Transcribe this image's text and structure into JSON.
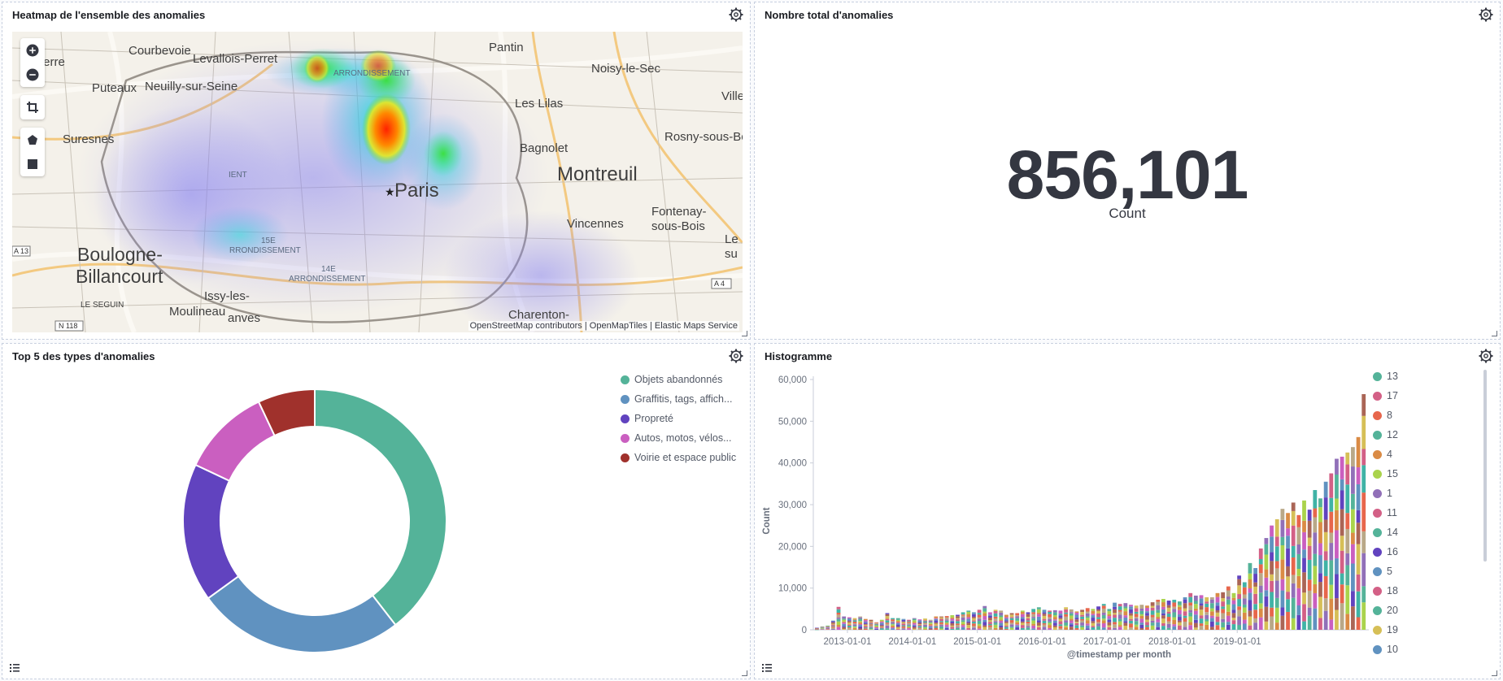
{
  "heatmap_panel": {
    "title": "Heatmap de l'ensemble des anomalies",
    "place_labels": [
      "Courbevoie",
      "Levallois-Perret",
      "Pantin",
      "Noisy-le-Sec",
      "Puteaux",
      "Neuilly-sur-Seine",
      "Les Lilas",
      "Suresnes",
      "Bagnolet",
      "Rosny-sous-Bo",
      "Montreuil",
      "Paris",
      "Fontenay-",
      "sous-Bois",
      "Vincennes",
      "Boulogne-",
      "Billancourt",
      "Issy-les-",
      "Moulineau",
      "Charenton-",
      "LE SEGUIN",
      "ARRONDISSEMENT",
      "15E",
      "RRONDISSEMENT",
      "14E",
      "ARRONDISSEMENT",
      "IENT",
      "Ville",
      "Le",
      "su",
      "terre",
      "anves"
    ],
    "road_badges": [
      "A 13",
      "A 4",
      "N 118"
    ],
    "attribution": [
      "OpenStreetMap contributors",
      "OpenMapTiles",
      "Elastic Maps Service"
    ],
    "icons": [
      "zoom-in-icon",
      "zoom-out-icon",
      "crop-icon",
      "polygon-icon",
      "square-icon"
    ]
  },
  "metric_panel": {
    "title": "Nombre total d'anomalies",
    "value": "856,101",
    "label": "Count"
  },
  "donut_panel": {
    "title": "Top 5 des types d'anomalies",
    "legend": [
      {
        "label": "Objets abandonnés",
        "color": "#54b399"
      },
      {
        "label": "Graffitis, tags, affich...",
        "color": "#6092c0"
      },
      {
        "label": "Propreté",
        "color": "#6143bf"
      },
      {
        "label": "Autos, motos, vélos...",
        "color": "#ca5fc0"
      },
      {
        "label": "Voirie et espace public",
        "color": "#a0312c"
      }
    ]
  },
  "histogram_panel": {
    "title": "Histogramme",
    "x_title": "@timestamp per month",
    "y_title": "Count",
    "legend": [
      {
        "label": "13",
        "color": "#54b399"
      },
      {
        "label": "17",
        "color": "#d36086"
      },
      {
        "label": "8",
        "color": "#e7664c"
      },
      {
        "label": "12",
        "color": "#54b399"
      },
      {
        "label": "4",
        "color": "#da8b45"
      },
      {
        "label": "15",
        "color": "#aad34c"
      },
      {
        "label": "1",
        "color": "#9170b8"
      },
      {
        "label": "11",
        "color": "#d36086"
      },
      {
        "label": "14",
        "color": "#54b399"
      },
      {
        "label": "16",
        "color": "#6143bf"
      },
      {
        "label": "5",
        "color": "#6092c0"
      },
      {
        "label": "18",
        "color": "#d36086"
      },
      {
        "label": "20",
        "color": "#54b399"
      },
      {
        "label": "19",
        "color": "#d6bf57"
      },
      {
        "label": "10",
        "color": "#6092c0"
      }
    ]
  },
  "chart_data": [
    {
      "type": "pie",
      "title": "Top 5 des types d'anomalies",
      "categories": [
        "Objets abandonnés",
        "Graffitis, tags, affich...",
        "Propreté",
        "Autos, motos, vélos...",
        "Voirie et espace public"
      ],
      "values": [
        39.5,
        25.5,
        17,
        11,
        7
      ],
      "colors": [
        "#54b399",
        "#6092c0",
        "#6143bf",
        "#ca5fc0",
        "#a0312c"
      ]
    },
    {
      "type": "bar",
      "title": "Histogramme",
      "xlabel": "@timestamp per month",
      "ylabel": "Count",
      "ylim": [
        0,
        60000
      ],
      "yticks": [
        "0",
        "10,000",
        "20,000",
        "30,000",
        "40,000",
        "50,000",
        "60,000"
      ],
      "xticks": [
        "2013-01-01",
        "2014-01-01",
        "2015-01-01",
        "2016-01-01",
        "2017-01-01",
        "2018-01-01",
        "2019-01-01"
      ],
      "x_start": "2012-07",
      "values": [
        500,
        800,
        1000,
        2200,
        5500,
        3200,
        3000,
        2800,
        3200,
        2600,
        2400,
        1800,
        2400,
        4000,
        2800,
        2800,
        2600,
        2400,
        2800,
        2500,
        2700,
        2400,
        3200,
        3200,
        3300,
        3500,
        3600,
        4200,
        4600,
        4200,
        4800,
        5700,
        4200,
        4800,
        4600,
        3600,
        4000,
        4000,
        4600,
        4200,
        5000,
        5400,
        4800,
        4600,
        4700,
        4600,
        5400,
        4900,
        4400,
        4800,
        5200,
        5000,
        5600,
        6200,
        5000,
        6500,
        6200,
        6400,
        6000,
        5800,
        6000,
        5800,
        6600,
        7200,
        7400,
        7000,
        7200,
        6800,
        7800,
        8800,
        8200,
        8300,
        7800,
        7800,
        8800,
        9000,
        10400,
        8800,
        13000,
        11400,
        16000,
        14800,
        19500,
        22000,
        25000,
        26500,
        29000,
        28000,
        30500,
        27500,
        31000,
        28800,
        33500,
        31500,
        35500,
        37500,
        41000,
        41500,
        42500,
        43800,
        46200,
        56500
      ],
      "series_colors": [
        "#54b399",
        "#6092c0",
        "#d36086",
        "#9170b8",
        "#ca5fc0",
        "#d6bf57",
        "#b9a888",
        "#da8b45",
        "#aa6556",
        "#e7664c",
        "#aad34c",
        "#6143bf",
        "#40b3a6"
      ]
    }
  ]
}
